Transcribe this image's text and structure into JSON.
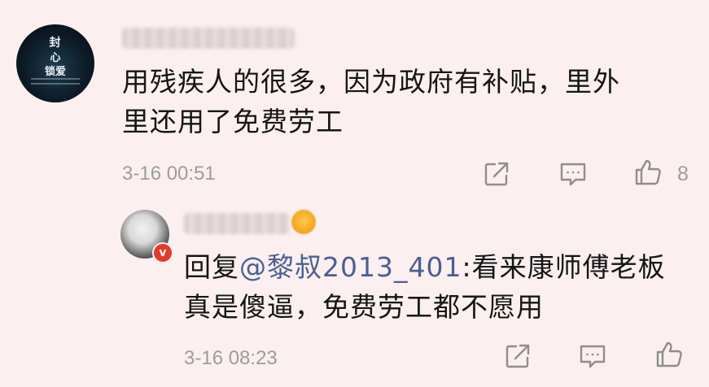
{
  "comment": {
    "avatar_lines": [
      "封",
      "心",
      "锁爱"
    ],
    "text_line1": "用残疾人的很多，因为政府有补贴，里外",
    "text_line2": "里还用了免费劳工",
    "timestamp": "3-16 00:51",
    "like_count": "8",
    "icons": [
      "share-icon",
      "comment-icon",
      "like-icon"
    ]
  },
  "reply": {
    "prefix": "回复",
    "mention": "@黎叔2013_401",
    "text_line1_rest": ":看来康师傅老板",
    "text_line2": "真是傻逼，免费劳工都不愿用",
    "timestamp": "3-16 08:23",
    "verified_glyph": "v",
    "icons": [
      "share-icon",
      "comment-icon",
      "like-icon"
    ]
  },
  "colors": {
    "background": "#fbefef",
    "mention": "#4a5f93",
    "meta": "#9d9d9d",
    "verified": "#e23a2d"
  }
}
